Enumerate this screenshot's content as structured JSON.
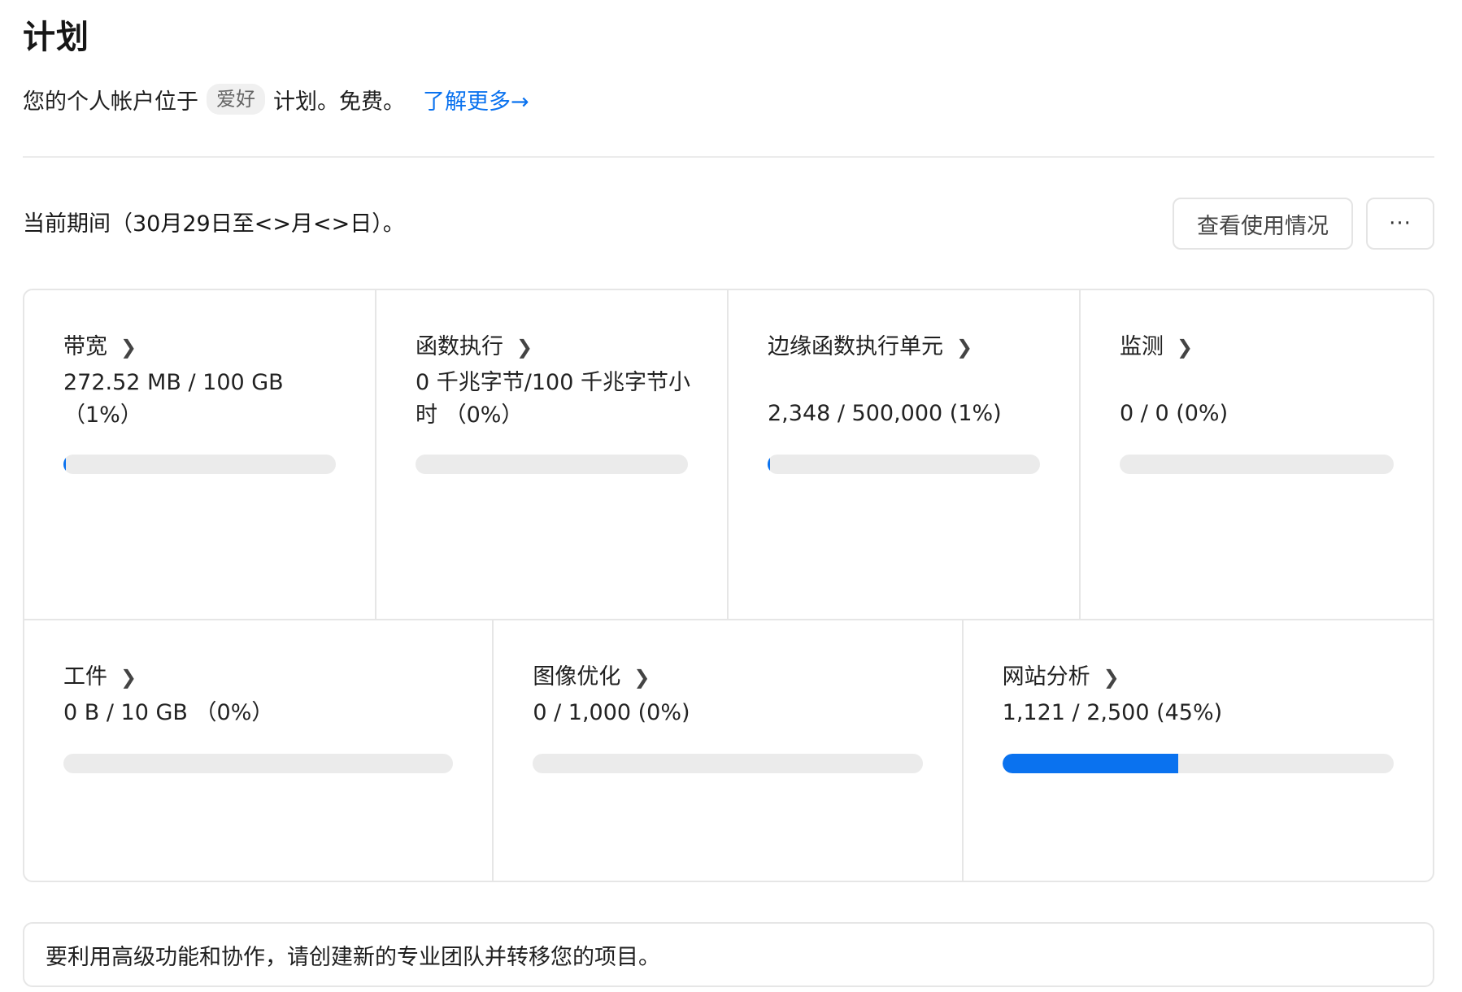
{
  "page": {
    "title": "计划"
  },
  "plan": {
    "desc_prefix": "您的个人帐户位于",
    "plan_name": "爱好",
    "desc_suffix": "计划。免费。",
    "learn_more": "了解更多→"
  },
  "period": {
    "text": "当前期间（30月29日至<>月<>日）。",
    "view_usage": "查看使用情况",
    "more": "···"
  },
  "usage": {
    "top": [
      {
        "title": "带宽",
        "value": "272.52 MB / 100 GB （1%）",
        "percent": 1
      },
      {
        "title": "函数执行",
        "value": "0 千兆字节/100 千兆字节小时 （0%）",
        "percent": 0
      },
      {
        "title": "边缘函数执行单元",
        "value": "2,348 / 500,000 (1%)",
        "percent": 1
      },
      {
        "title": "监测",
        "value": "0 / 0 (0%)",
        "percent": 0
      }
    ],
    "bottom": [
      {
        "title": "工件",
        "value": "0 B / 10 GB （0%）",
        "percent": 0
      },
      {
        "title": "图像优化",
        "value": "0 / 1,000 (0%)",
        "percent": 0
      },
      {
        "title": "网站分析",
        "value": "1,121 / 2,500 (45%)",
        "percent": 45
      }
    ],
    "fill_color": "#0a72ef",
    "track_color": "#ebebeb",
    "chevron_icon": "chevron-right-icon"
  },
  "notice": {
    "text": "要利用高级功能和协作，请创建新的专业团队并转移您的项目。"
  }
}
